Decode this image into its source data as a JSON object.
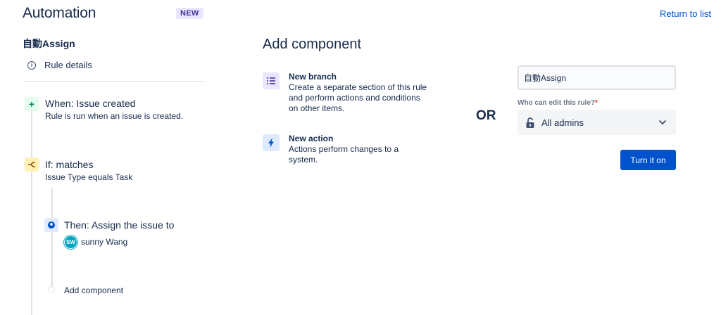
{
  "header": {
    "title": "Automation",
    "badge": "NEW",
    "return_link": "Return to list"
  },
  "rule": {
    "name": "自動Assign",
    "details_label": "Rule details",
    "trigger": {
      "title": "When: Issue created",
      "description": "Rule is run when an issue is created.",
      "icon": "plus-icon"
    },
    "condition": {
      "title": "If: matches",
      "description": "Issue Type equals Task",
      "icon": "branch-condition-icon"
    },
    "action": {
      "title": "Then: Assign the issue to",
      "assignee_initials": "SW",
      "assignee_name": "sunny Wang",
      "icon": "user-icon"
    },
    "add_component_label": "Add component"
  },
  "add_component_panel": {
    "heading": "Add component",
    "options": [
      {
        "title": "New branch",
        "description": "Create a separate section of this rule and perform actions and conditions on other items.",
        "icon": "list-branch-icon"
      },
      {
        "title": "New action",
        "description": "Actions perform changes to a system.",
        "icon": "lightning-bolt-icon"
      }
    ]
  },
  "separator_text": "OR",
  "form": {
    "rule_name_value": "自動Assign",
    "editor_label": "Who can edit this rule?",
    "required_marker": "*",
    "editor_value": "All admins",
    "submit_label": "Turn it on"
  },
  "colors": {
    "primary": "#0052cc",
    "text": "#172b4d",
    "badge_bg": "#eae6ff",
    "trigger_bg": "#e3fcef",
    "condition_bg": "#fff0b3",
    "action_bg": "#deebff",
    "avatar_bg": "#00a3bf",
    "required": "#de350b"
  }
}
